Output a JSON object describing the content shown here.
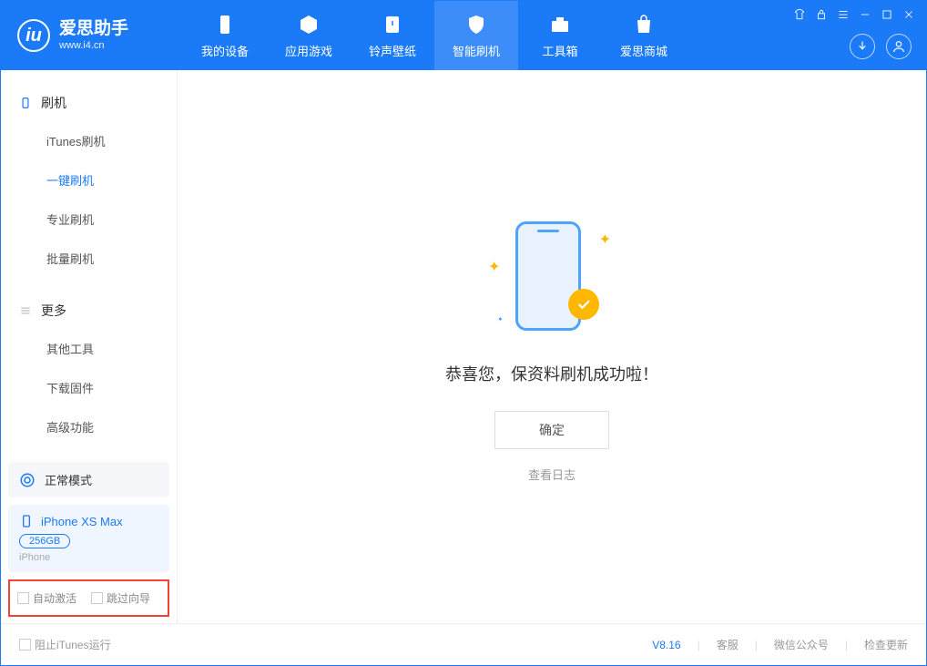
{
  "app": {
    "title": "爱思助手",
    "subtitle": "www.i4.cn"
  },
  "nav": {
    "tabs": [
      {
        "label": "我的设备"
      },
      {
        "label": "应用游戏"
      },
      {
        "label": "铃声壁纸"
      },
      {
        "label": "智能刷机"
      },
      {
        "label": "工具箱"
      },
      {
        "label": "爱思商城"
      }
    ]
  },
  "sidebar": {
    "section1": {
      "title": "刷机",
      "items": [
        "iTunes刷机",
        "一键刷机",
        "专业刷机",
        "批量刷机"
      ]
    },
    "section2": {
      "title": "更多",
      "items": [
        "其他工具",
        "下载固件",
        "高级功能"
      ]
    },
    "mode": "正常模式",
    "device": {
      "name": "iPhone XS Max",
      "storage": "256GB",
      "type": "iPhone"
    },
    "checkboxes": {
      "auto_activate": "自动激活",
      "skip_guide": "跳过向导"
    }
  },
  "main": {
    "success_text": "恭喜您，保资料刷机成功啦！",
    "confirm_label": "确定",
    "log_link": "查看日志"
  },
  "footer": {
    "stop_itunes": "阻止iTunes运行",
    "version": "V8.16",
    "links": [
      "客服",
      "微信公众号",
      "检查更新"
    ]
  }
}
